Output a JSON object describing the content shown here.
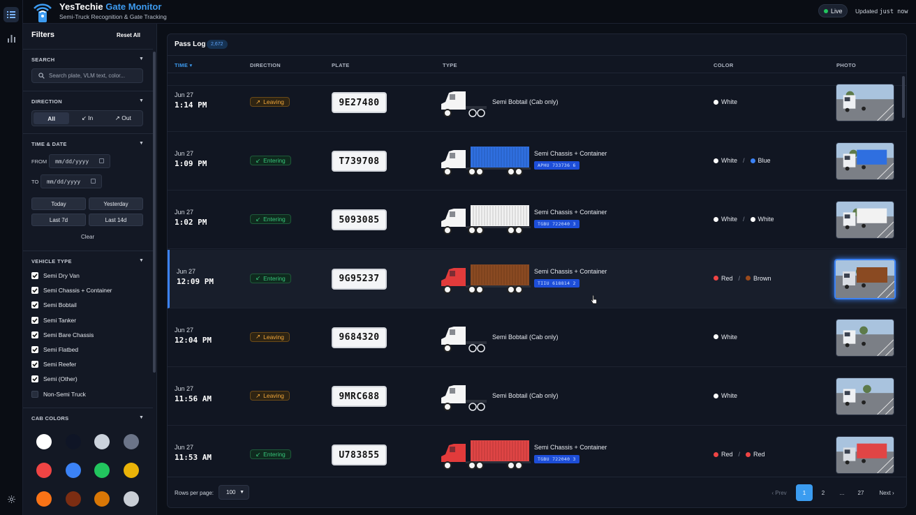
{
  "header": {
    "title_main": "YesTechie",
    "title_accent": "Gate Monitor",
    "subtitle": "Semi-Truck Recognition & Gate Tracking",
    "live_label": "Live",
    "updated_prefix": "Updated",
    "updated_value": "just now"
  },
  "rail": {
    "icons": [
      "list-icon",
      "bar-chart-icon",
      "gear-icon"
    ]
  },
  "filters": {
    "title": "Filters",
    "reset_label": "Reset All",
    "search": {
      "title": "SEARCH",
      "placeholder": "Search plate, VLM text, color..."
    },
    "direction": {
      "title": "DIRECTION",
      "options": [
        "All",
        "↙ In",
        "↗ Out"
      ],
      "selected": "All"
    },
    "time_date": {
      "title": "TIME & DATE",
      "from_label": "FROM",
      "to_label": "TO",
      "from_value": "mm/dd/yyyy",
      "to_value": "mm/dd/yyyy",
      "quick": [
        "Today",
        "Yesterday",
        "Last 7d",
        "Last 14d"
      ],
      "clear_label": "Clear"
    },
    "vehicle_type": {
      "title": "VEHICLE TYPE",
      "items": [
        {
          "label": "Semi Dry Van",
          "checked": true
        },
        {
          "label": "Semi Chassis + Container",
          "checked": true
        },
        {
          "label": "Semi Bobtail",
          "checked": true
        },
        {
          "label": "Semi Tanker",
          "checked": true
        },
        {
          "label": "Semi Bare Chassis",
          "checked": true
        },
        {
          "label": "Semi Flatbed",
          "checked": true
        },
        {
          "label": "Semi Reefer",
          "checked": true
        },
        {
          "label": "Semi (Other)",
          "checked": true
        },
        {
          "label": "Non-Semi Truck",
          "checked": false
        }
      ]
    },
    "cab_colors": {
      "title": "CAB COLORS",
      "swatches": [
        "#ffffff",
        "#0f1526",
        "#cbd2dc",
        "#6b7488",
        "#ef4444",
        "#3b82f6",
        "#22c55e",
        "#eab308",
        "#f97316",
        "#7c2d12",
        "#d97706",
        "#c9ced6"
      ]
    }
  },
  "pass_log": {
    "title": "Pass Log",
    "count": "2,672",
    "columns": [
      "TIME",
      "DIRECTION",
      "PLATE",
      "TYPE",
      "COLOR",
      "PHOTO"
    ],
    "sort_indicator": "▾",
    "rows": [
      {
        "date": "Jun 27",
        "time": "1:14 PM",
        "direction": "Leaving",
        "plate": "9E27480",
        "type": "Semi Bobtail (Cab only)",
        "container_id": "",
        "cab_color": "#f5f5f5",
        "cargo_color": "",
        "colors": [
          {
            "name": "White",
            "hex": "#ffffff"
          }
        ]
      },
      {
        "date": "Jun 27",
        "time": "1:09 PM",
        "direction": "Entering",
        "plate": "T739708",
        "type": "Semi Chassis + Container",
        "container_id": "APHU 733736 6",
        "cab_color": "#f5f5f5",
        "cargo_color": "#2f6fe0",
        "colors": [
          {
            "name": "White",
            "hex": "#ffffff"
          },
          {
            "name": "Blue",
            "hex": "#3b82f6"
          }
        ]
      },
      {
        "date": "Jun 27",
        "time": "1:02 PM",
        "direction": "Entering",
        "plate": "5093085",
        "type": "Semi Chassis + Container",
        "container_id": "TGBU 722040 3",
        "cab_color": "#f5f5f5",
        "cargo_color": "#f2f2f2",
        "colors": [
          {
            "name": "White",
            "hex": "#ffffff"
          },
          {
            "name": "White",
            "hex": "#ffffff"
          }
        ]
      },
      {
        "date": "Jun 27",
        "time": "12:09 PM",
        "direction": "Entering",
        "plate": "9G95237",
        "type": "Semi Chassis + Container",
        "container_id": "TIIU 618814 2",
        "cab_color": "#e23b3b",
        "cargo_color": "#8a4a22",
        "colors": [
          {
            "name": "Red",
            "hex": "#ef4444"
          },
          {
            "name": "Brown",
            "hex": "#9a4a1c"
          }
        ],
        "selected": true
      },
      {
        "date": "Jun 27",
        "time": "12:04 PM",
        "direction": "Leaving",
        "plate": "9684320",
        "type": "Semi Bobtail (Cab only)",
        "container_id": "",
        "cab_color": "#f5f5f5",
        "cargo_color": "",
        "colors": [
          {
            "name": "White",
            "hex": "#ffffff"
          }
        ]
      },
      {
        "date": "Jun 27",
        "time": "11:56 AM",
        "direction": "Leaving",
        "plate": "9MRC688",
        "type": "Semi Bobtail (Cab only)",
        "container_id": "",
        "cab_color": "#f5f5f5",
        "cargo_color": "",
        "colors": [
          {
            "name": "White",
            "hex": "#ffffff"
          }
        ]
      },
      {
        "date": "Jun 27",
        "time": "11:53 AM",
        "direction": "Entering",
        "plate": "U783855",
        "type": "Semi Chassis + Container",
        "container_id": "TGBU 722040 3",
        "cab_color": "#e23b3b",
        "cargo_color": "#e04545",
        "colors": [
          {
            "name": "Red",
            "hex": "#ef4444"
          },
          {
            "name": "Red",
            "hex": "#ef4444"
          }
        ]
      }
    ]
  },
  "pagination": {
    "rows_per_page_label": "Rows per page:",
    "rows_per_page_value": "100",
    "prev_label": "‹ Prev",
    "pages": [
      "1",
      "2",
      "...",
      "27"
    ],
    "current_page": "1",
    "next_label": "Next ›"
  }
}
